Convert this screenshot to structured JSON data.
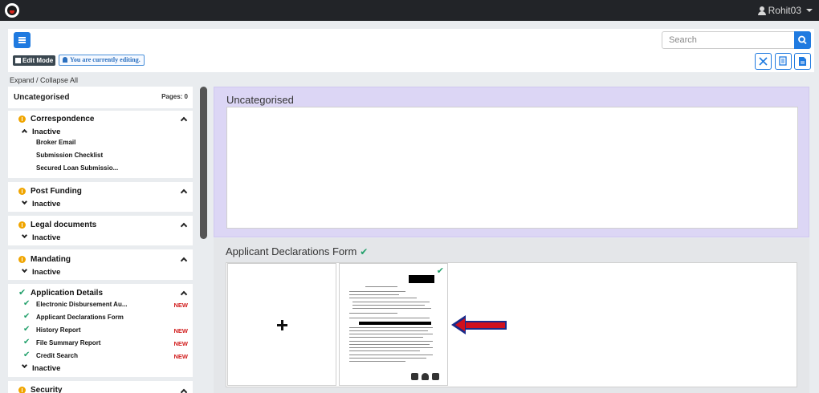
{
  "app": {
    "user_name": "Rohit03"
  },
  "toolbar": {
    "edit_mode_label": "Edit Mode",
    "editing_notice": "You are currently editing.",
    "search_placeholder": "Search"
  },
  "expand_collapse_label": "Expand / Collapse All",
  "sidebar": {
    "header": {
      "title": "Uncategorised",
      "pages": "Pages: 0"
    },
    "groups": [
      {
        "title": "Correspondence",
        "status_icon": "info-icon",
        "status": "Inactive",
        "items": [
          "Broker Email",
          "Submission Checklist",
          "Secured Loan Submissio..."
        ]
      },
      {
        "title": "Post Funding",
        "status_icon": "info-icon",
        "status": "Inactive"
      },
      {
        "title": "Legal documents",
        "status_icon": "info-icon",
        "status": "Inactive"
      },
      {
        "title": "Mandating",
        "status_icon": "info-icon",
        "status": "Inactive"
      },
      {
        "title": "Application Details",
        "status_icon": "check-icon",
        "status": "Inactive",
        "items": [
          {
            "label": "Electronic Disbursement Au...",
            "badge": "NEW"
          },
          {
            "label": "Applicant Declarations Form",
            "badge": ""
          },
          {
            "label": "History Report",
            "badge": "NEW"
          },
          {
            "label": "File Summary Report",
            "badge": "NEW"
          },
          {
            "label": "Credit Search",
            "badge": "NEW"
          }
        ]
      },
      {
        "title": "Security",
        "status_icon": "info-icon"
      }
    ]
  },
  "main": {
    "sections": [
      {
        "title": "Uncategorised"
      },
      {
        "title": "Applicant Declarations Form",
        "checked": true
      }
    ]
  },
  "colors": {
    "accent": "#1f7ae0",
    "check": "#22a06b",
    "info": "#f0a500",
    "new_badge": "#d11b1b",
    "uncategorised_bg": "#dcd6f5",
    "topbar": "#222428"
  }
}
